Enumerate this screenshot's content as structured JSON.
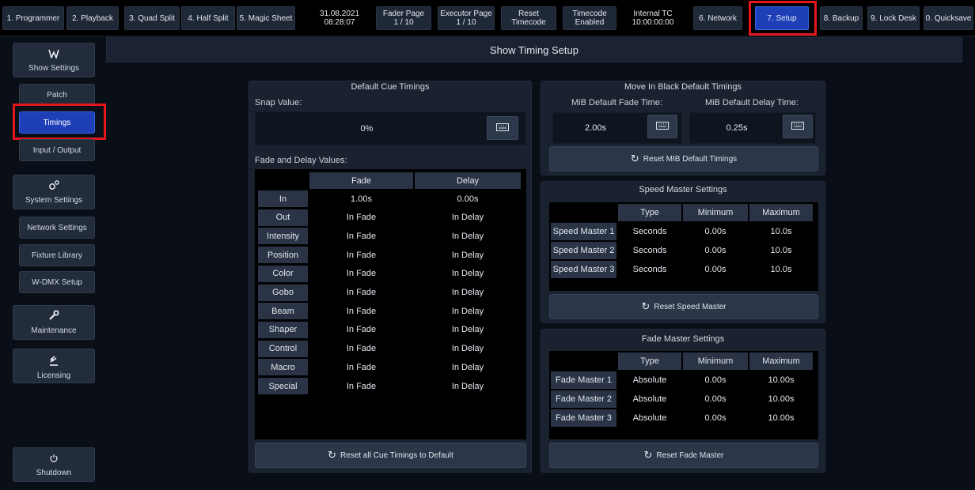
{
  "topbar": {
    "tabs": [
      {
        "label": "1. Programmer"
      },
      {
        "label": "2. Playback"
      },
      {
        "label": "3. Quad Split"
      },
      {
        "label": "4. Half Split"
      },
      {
        "label": "5. Magic Sheet"
      }
    ],
    "date": "31.08.2021",
    "time": "08:28:07",
    "fader_page_label": "Fader Page",
    "fader_page_value": "1 / 10",
    "executor_page_label": "Executor Page",
    "executor_page_value": "1 / 10",
    "reset_timecode_l1": "Reset",
    "reset_timecode_l2": "Timecode",
    "timecode_l1": "Timecode",
    "timecode_l2": "Enabled",
    "internal_tc_l1": "Internal TC",
    "internal_tc_l2": "10:00:00:00",
    "right_tabs": [
      {
        "label": "6. Network"
      },
      {
        "label": "7. Setup"
      },
      {
        "label": "8. Backup"
      },
      {
        "label": "9. Lock Desk"
      },
      {
        "label": "0. Quicksave"
      }
    ],
    "active_tab": "7. Setup"
  },
  "sidebar": {
    "show_settings": {
      "label": "Show Settings",
      "icon": "logo-icon"
    },
    "show_items": [
      {
        "label": "Patch"
      },
      {
        "label": "Timings"
      },
      {
        "label": "Input / Output"
      }
    ],
    "system_settings": {
      "label": "System Settings",
      "icon": "gears-icon"
    },
    "system_items": [
      {
        "label": "Network Settings"
      },
      {
        "label": "Fixture Library"
      },
      {
        "label": "W-DMX Setup"
      }
    ],
    "maintenance": {
      "label": "Maintenance",
      "icon": "wrench-icon"
    },
    "licensing": {
      "label": "Licensing",
      "icon": "gavel-icon"
    },
    "shutdown": {
      "label": "Shutdown",
      "icon": "power-icon"
    },
    "active_item": "Timings"
  },
  "page_title": "Show Timing Setup",
  "default_cue": {
    "title": "Default Cue Timings",
    "snap_label": "Snap Value:",
    "snap_value": "0%",
    "fade_delay_label": "Fade and Delay Values:",
    "columns": [
      "Fade",
      "Delay"
    ],
    "rows": [
      {
        "name": "In",
        "fade": "1.00s",
        "delay": "0.00s"
      },
      {
        "name": "Out",
        "fade": "In Fade",
        "delay": "In Delay"
      },
      {
        "name": "Intensity",
        "fade": "In Fade",
        "delay": "In Delay"
      },
      {
        "name": "Position",
        "fade": "In Fade",
        "delay": "In Delay"
      },
      {
        "name": "Color",
        "fade": "In Fade",
        "delay": "In Delay"
      },
      {
        "name": "Gobo",
        "fade": "In Fade",
        "delay": "In Delay"
      },
      {
        "name": "Beam",
        "fade": "In Fade",
        "delay": "In Delay"
      },
      {
        "name": "Shaper",
        "fade": "In Fade",
        "delay": "In Delay"
      },
      {
        "name": "Control",
        "fade": "In Fade",
        "delay": "In Delay"
      },
      {
        "name": "Macro",
        "fade": "In Fade",
        "delay": "In Delay"
      },
      {
        "name": "Special",
        "fade": "In Fade",
        "delay": "In Delay"
      }
    ],
    "reset_label": "Reset all Cue Timings to Default"
  },
  "mib": {
    "title": "Move In Black Default Timings",
    "fade_label": "MiB Default Fade Time:",
    "fade_value": "2.00s",
    "delay_label": "MiB Default Delay Time:",
    "delay_value": "0.25s",
    "reset_label": "Reset MIB Default Timings"
  },
  "speed_master": {
    "title": "Speed Master Settings",
    "columns": [
      "Type",
      "Minimum",
      "Maximum"
    ],
    "rows": [
      {
        "name": "Speed Master 1",
        "type": "Seconds",
        "min": "0.00s",
        "max": "10.0s"
      },
      {
        "name": "Speed Master 2",
        "type": "Seconds",
        "min": "0.00s",
        "max": "10.0s"
      },
      {
        "name": "Speed Master 3",
        "type": "Seconds",
        "min": "0.00s",
        "max": "10.0s"
      }
    ],
    "reset_label": "Reset Speed Master"
  },
  "fade_master": {
    "title": "Fade Master Settings",
    "columns": [
      "Type",
      "Minimum",
      "Maximum"
    ],
    "rows": [
      {
        "name": "Fade Master 1",
        "type": "Absolute",
        "min": "0.00s",
        "max": "10.00s"
      },
      {
        "name": "Fade Master 2",
        "type": "Absolute",
        "min": "0.00s",
        "max": "10.00s"
      },
      {
        "name": "Fade Master 3",
        "type": "Absolute",
        "min": "0.00s",
        "max": "10.00s"
      }
    ],
    "reset_label": "Reset Fade Master"
  },
  "colors": {
    "accent": "#1e3fb8",
    "highlight": "#e2161b"
  }
}
